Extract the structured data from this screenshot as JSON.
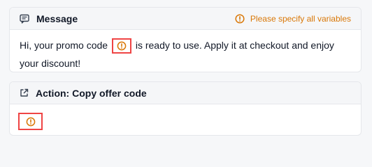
{
  "message_card": {
    "title": "Message",
    "icon": "message-square-icon",
    "warning": "Please specify all variables",
    "warning_icon": "warning-circle-icon",
    "text_before": "Hi, your promo code",
    "text_after": "is ready to use. Apply it at checkout and enjoy your discount!"
  },
  "action_card": {
    "title": "Action: Copy offer code",
    "icon": "external-link-icon"
  },
  "colors": {
    "warning": "#d97706",
    "highlight_border": "#ef4444"
  }
}
